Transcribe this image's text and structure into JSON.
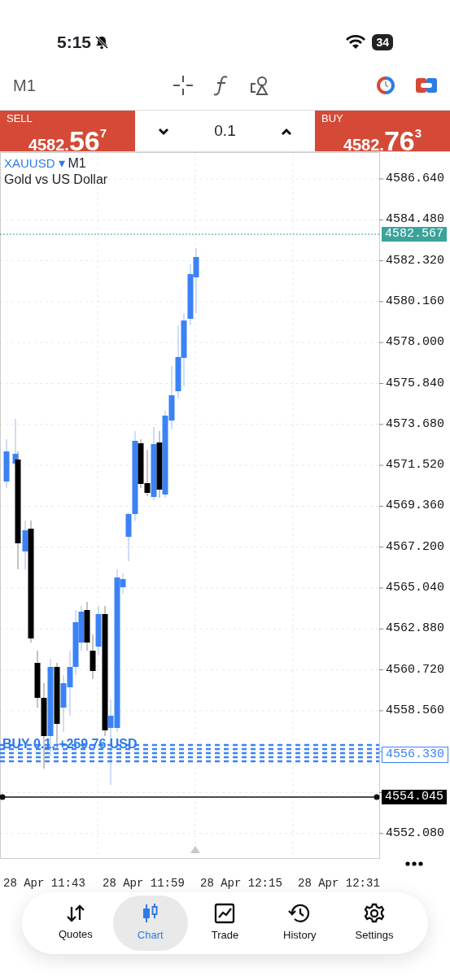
{
  "status_bar": {
    "time": "5:15",
    "battery": "34"
  },
  "toolbar": {
    "timeframe": "M1"
  },
  "trade_panel": {
    "sell": {
      "label": "SELL",
      "price_main": "4582.",
      "price_big": "56",
      "price_sup": "7"
    },
    "volume": "0.1",
    "buy": {
      "label": "BUY",
      "price_main": "4582.",
      "price_big": "76",
      "price_sup": "3"
    }
  },
  "chart": {
    "symbol": "XAUUSD",
    "symbol_marker": "▾",
    "timeframe": "M1",
    "description": "Gold vs US Dollar",
    "y_axis_labels": [
      "4586.640",
      "4584.480",
      "4582.320",
      "4580.160",
      "4578.000",
      "4575.840",
      "4573.680",
      "4571.520",
      "4569.360",
      "4567.200",
      "4565.040",
      "4562.880",
      "4560.720",
      "4558.560",
      "4552.080"
    ],
    "x_axis_labels": [
      "28 Apr 11:43",
      "28 Apr 11:59",
      "28 Apr 12:15",
      "28 Apr 12:31"
    ],
    "price_tags": [
      {
        "kind": "bid",
        "text": "4582.567"
      },
      {
        "kind": "order",
        "text": "4556.330"
      },
      {
        "kind": "line",
        "text": "4554.045"
      }
    ],
    "order_label": "BUY 0.1, +259.76 USD"
  },
  "nav": [
    {
      "label": "Quotes",
      "selected": false
    },
    {
      "label": "Chart",
      "selected": true
    },
    {
      "label": "Trade",
      "selected": false
    },
    {
      "label": "History",
      "selected": false
    },
    {
      "label": "Settings",
      "selected": false
    }
  ]
}
